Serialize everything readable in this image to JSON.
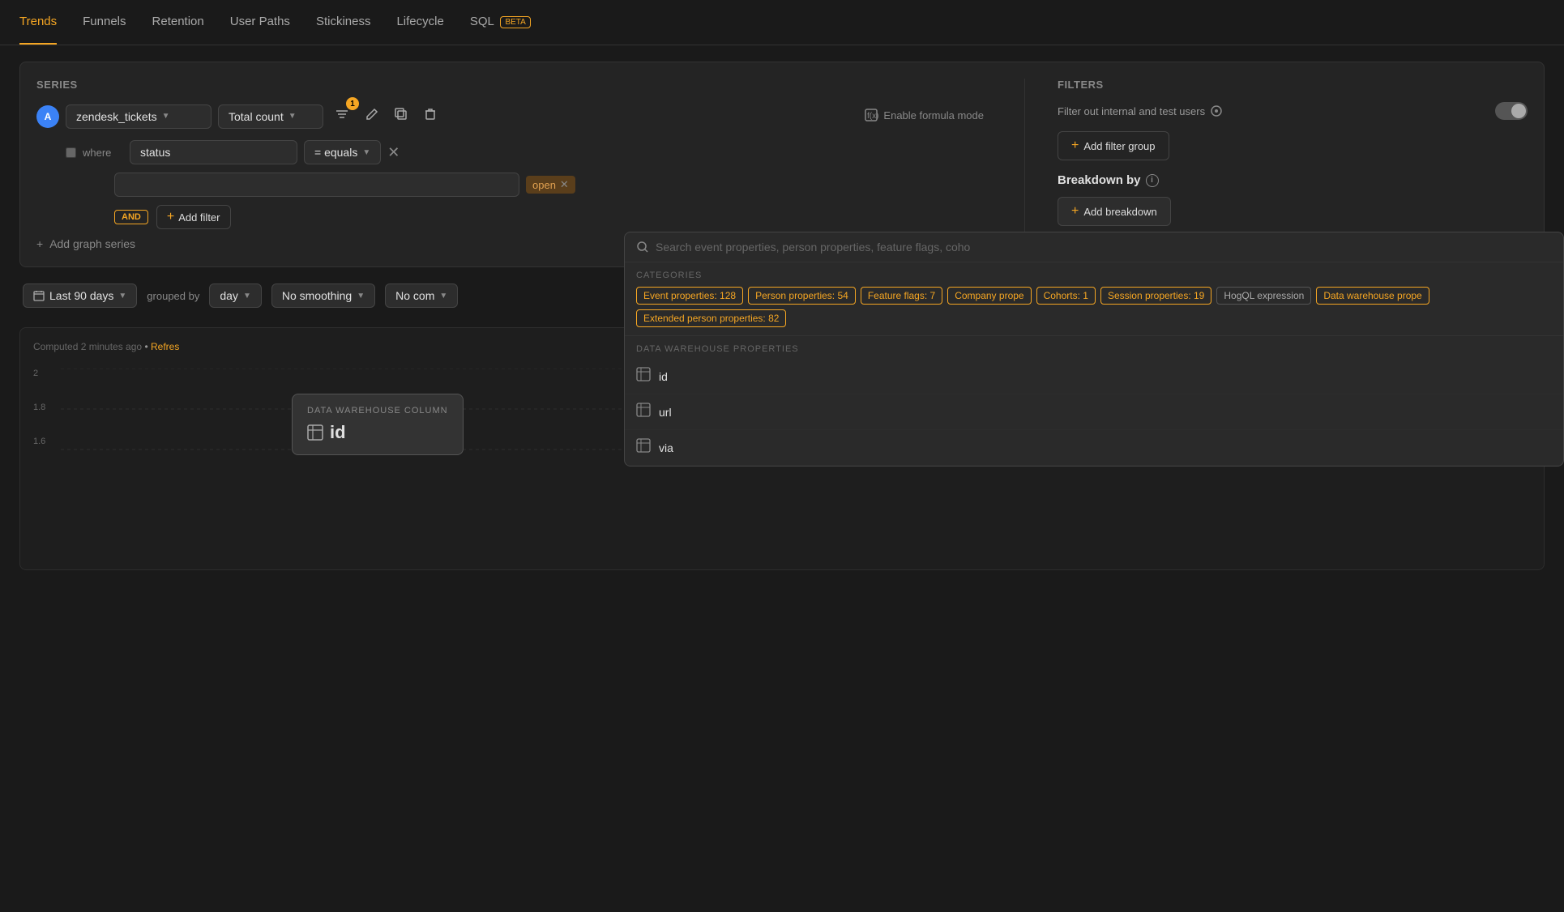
{
  "nav": {
    "items": [
      {
        "label": "Trends",
        "active": true
      },
      {
        "label": "Funnels",
        "active": false
      },
      {
        "label": "Retention",
        "active": false
      },
      {
        "label": "User Paths",
        "active": false
      },
      {
        "label": "Stickiness",
        "active": false
      },
      {
        "label": "Lifecycle",
        "active": false
      },
      {
        "label": "SQL",
        "active": false,
        "badge": "BETA"
      }
    ]
  },
  "series": {
    "title": "Series",
    "badge": "A",
    "event": "zendesk_tickets",
    "metric": "Total count",
    "notification_count": "1",
    "where_label": "where",
    "filter_field": "status",
    "filter_operator": "= equals",
    "filter_value": "open",
    "and_label": "AND",
    "add_filter_label": "Add filter",
    "add_series_label": "Add graph series"
  },
  "formula": {
    "label": "Enable formula mode"
  },
  "filters": {
    "title": "Filters",
    "internal_label": "Filter out internal and test users",
    "add_group_label": "Add filter group",
    "breakdown_title": "Breakdown by",
    "add_breakdown_label": "Add breakdown"
  },
  "bottom_bar": {
    "date_range": "Last 90 days",
    "grouped_by": "grouped by",
    "group_by_value": "day",
    "smoothing": "No smoothing",
    "compare": "No com"
  },
  "computed": {
    "label": "Computed 2 minutes ago",
    "refresh_label": "Refres"
  },
  "chart": {
    "y_values": [
      "2",
      "1.8",
      "1.6"
    ]
  },
  "search_dropdown": {
    "placeholder": "Search event properties, person properties, feature flags, coho",
    "categories_label": "CATEGORIES",
    "categories": [
      {
        "label": "Event properties: 128",
        "highlighted": true
      },
      {
        "label": "Person properties: 54",
        "highlighted": true
      },
      {
        "label": "Feature flags: 7",
        "highlighted": true
      },
      {
        "label": "Company prope",
        "highlighted": true
      },
      {
        "label": "Cohorts: 1",
        "highlighted": true
      },
      {
        "label": "Session properties: 19",
        "highlighted": true
      },
      {
        "label": "HogQL expression",
        "plain": true
      },
      {
        "label": "Data warehouse prope",
        "highlighted": true
      },
      {
        "label": "Extended person properties: 82",
        "highlighted": true
      }
    ],
    "dw_section_label": "DATA WAREHOUSE PROPERTIES",
    "dw_items": [
      {
        "label": "id"
      },
      {
        "label": "url"
      },
      {
        "label": "via"
      }
    ]
  },
  "dw_tooltip": {
    "label": "DATA WAREHOUSE COLUMN",
    "value": "id"
  }
}
